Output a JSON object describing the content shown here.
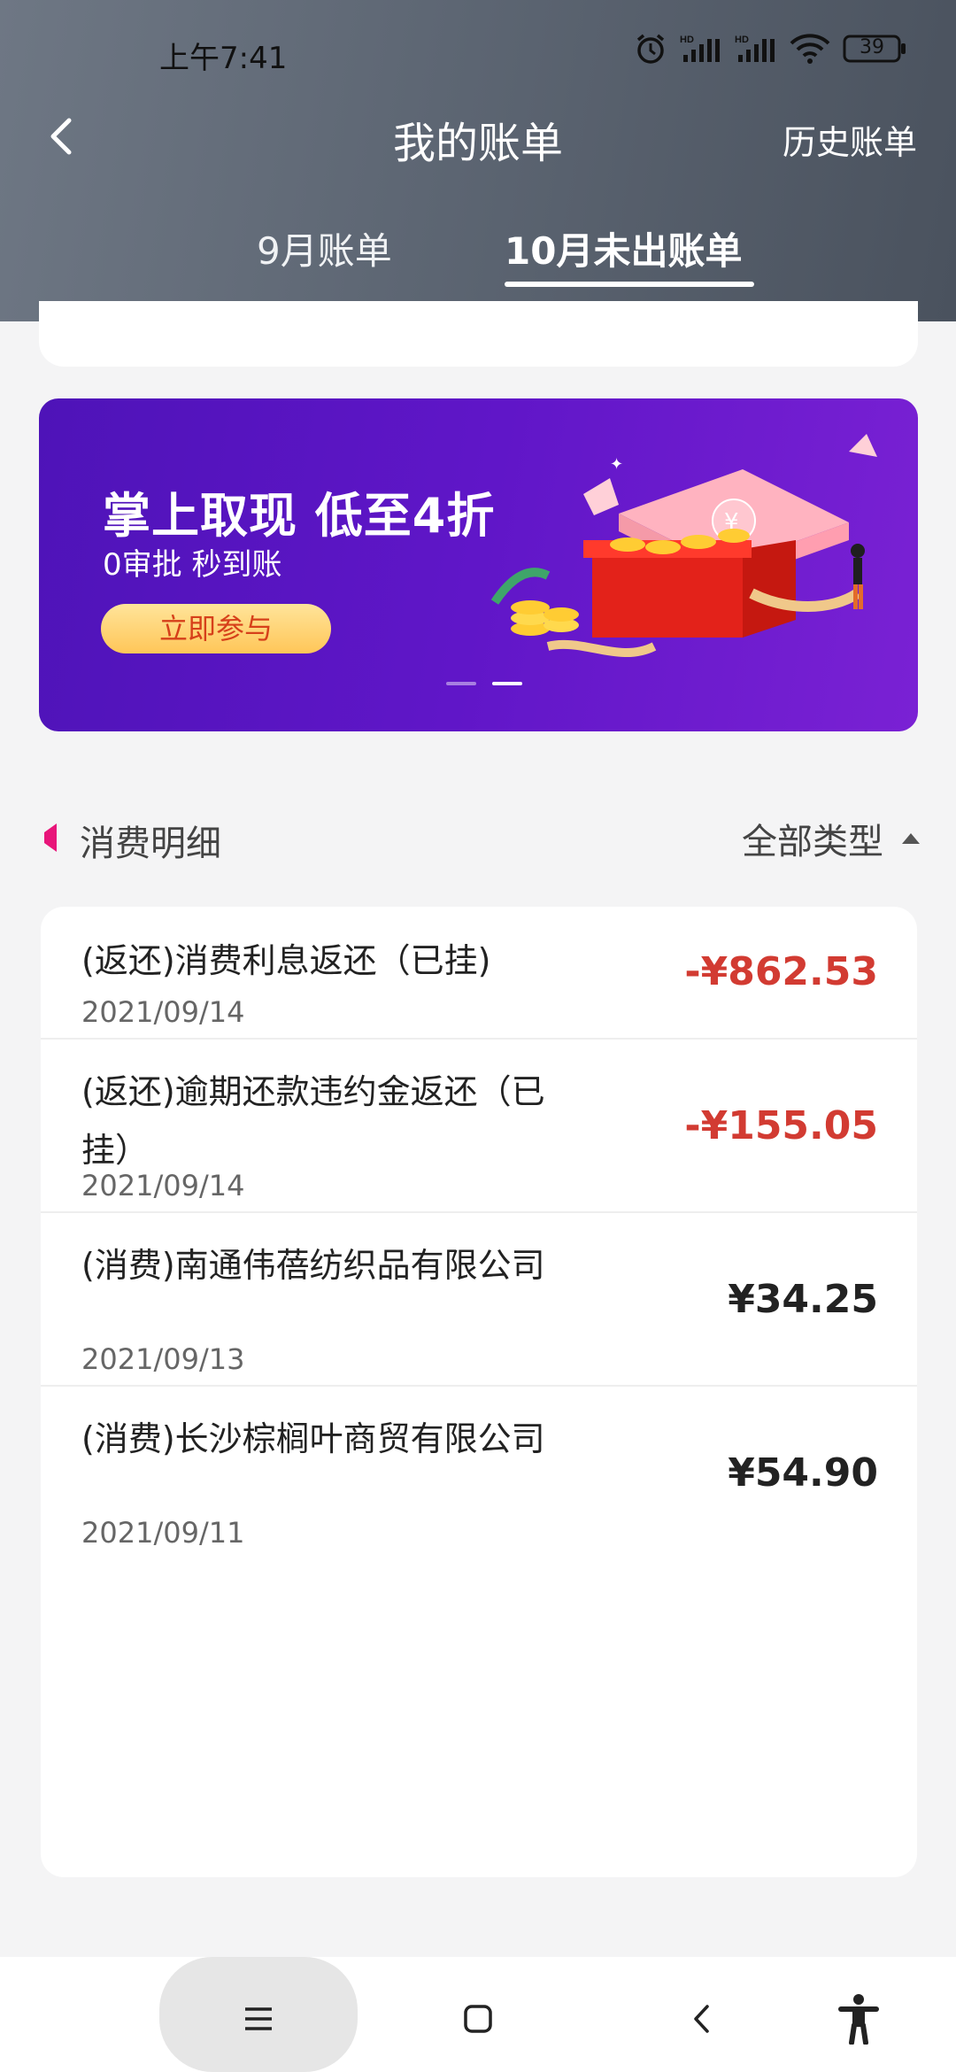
{
  "status": {
    "time": "上午7:41",
    "battery": "39"
  },
  "header": {
    "title": "我的账单",
    "history": "历史账单"
  },
  "tabs": [
    {
      "label": "9月账单"
    },
    {
      "label": "10月未出账单"
    }
  ],
  "banner": {
    "title": "掌上取现 低至4折",
    "subtitle": "0审批  秒到账",
    "button": "立即参与"
  },
  "section": {
    "title": "消费明细",
    "filter": "全部类型"
  },
  "items": [
    {
      "title": "(返还)消费利息返还（已挂)",
      "date": "2021/09/14",
      "amount": "-¥862.53"
    },
    {
      "title": "(返还)逾期还款违约金返还（已挂）",
      "date": "2021/09/14",
      "amount": "-¥155.05"
    },
    {
      "title": "(消费)南通伟蓓纺织品有限公司",
      "date": "2021/09/13",
      "amount": "¥34.25"
    },
    {
      "title": "(消费)长沙棕榈叶商贸有限公司",
      "date": "2021/09/11",
      "amount": "¥54.90"
    }
  ],
  "colors": {
    "negative": "#d23b32",
    "accent": "#e8157a",
    "banner": "#5b14c4"
  }
}
